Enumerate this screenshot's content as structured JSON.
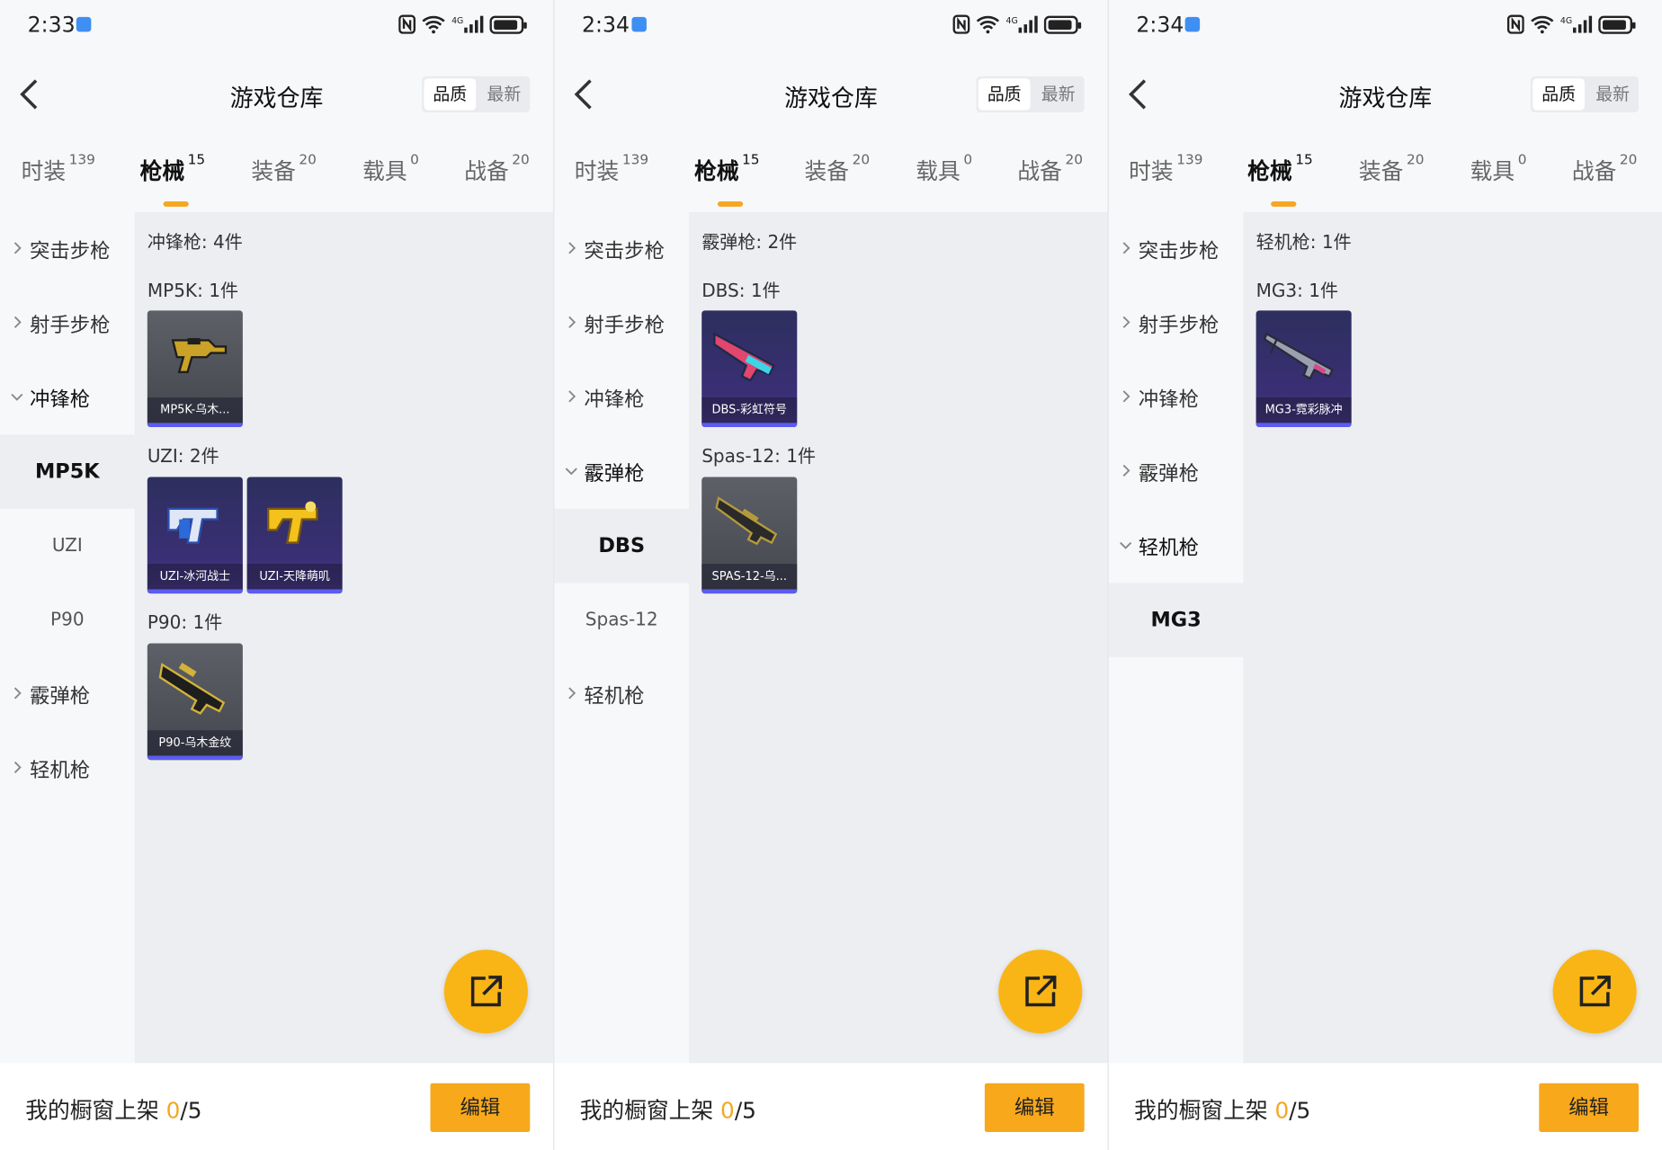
{
  "app": {
    "title": "游戏仓库",
    "sort_quality": "品质",
    "sort_newest": "最新"
  },
  "tabs": [
    {
      "label": "时装",
      "count": "139"
    },
    {
      "label": "枪械",
      "count": "15"
    },
    {
      "label": "装备",
      "count": "20"
    },
    {
      "label": "载具",
      "count": "0"
    },
    {
      "label": "战备",
      "count": "20"
    }
  ],
  "categories": {
    "assault": "突击步枪",
    "marksman": "射手步枪",
    "smg": "冲锋枪",
    "shotgun": "霰弹枪",
    "lmg": "轻机枪"
  },
  "bottom": {
    "label": "我的橱窗上架 ",
    "count": "0",
    "total": "/5",
    "edit": "编辑"
  },
  "panels": [
    {
      "time": "2:33",
      "subs": [
        "MP5K",
        "UZI",
        "P90"
      ],
      "group_title": "冲锋枪: 4件",
      "groups": [
        {
          "title": "MP5K: 1件",
          "items": [
            "MP5K-乌木..."
          ]
        },
        {
          "title": "UZI: 2件",
          "items": [
            "UZI-冰河战士",
            "UZI-天降萌叽"
          ]
        },
        {
          "title": "P90: 1件",
          "items": [
            "P90-乌木金纹"
          ]
        }
      ]
    },
    {
      "time": "2:34",
      "subs": [
        "DBS",
        "Spas-12"
      ],
      "group_title": "霰弹枪: 2件",
      "groups": [
        {
          "title": "DBS: 1件",
          "items": [
            "DBS-彩虹符号"
          ]
        },
        {
          "title": "Spas-12: 1件",
          "items": [
            "SPAS-12-乌..."
          ]
        }
      ]
    },
    {
      "time": "2:34",
      "subs": [
        "MG3"
      ],
      "group_title": "轻机枪: 1件",
      "groups": [
        {
          "title": "MG3: 1件",
          "items": [
            "MG3-霓彩脉冲"
          ]
        }
      ]
    }
  ],
  "colors": {
    "accent": "#f5a623",
    "fab": "#f9b515",
    "card_bar": "#5b5cf0"
  },
  "icons": [
    "back-icon",
    "share-icon",
    "chevron-right-icon",
    "chevron-down-icon",
    "wifi-icon",
    "battery-icon",
    "signal-icon",
    "nfc-icon"
  ]
}
